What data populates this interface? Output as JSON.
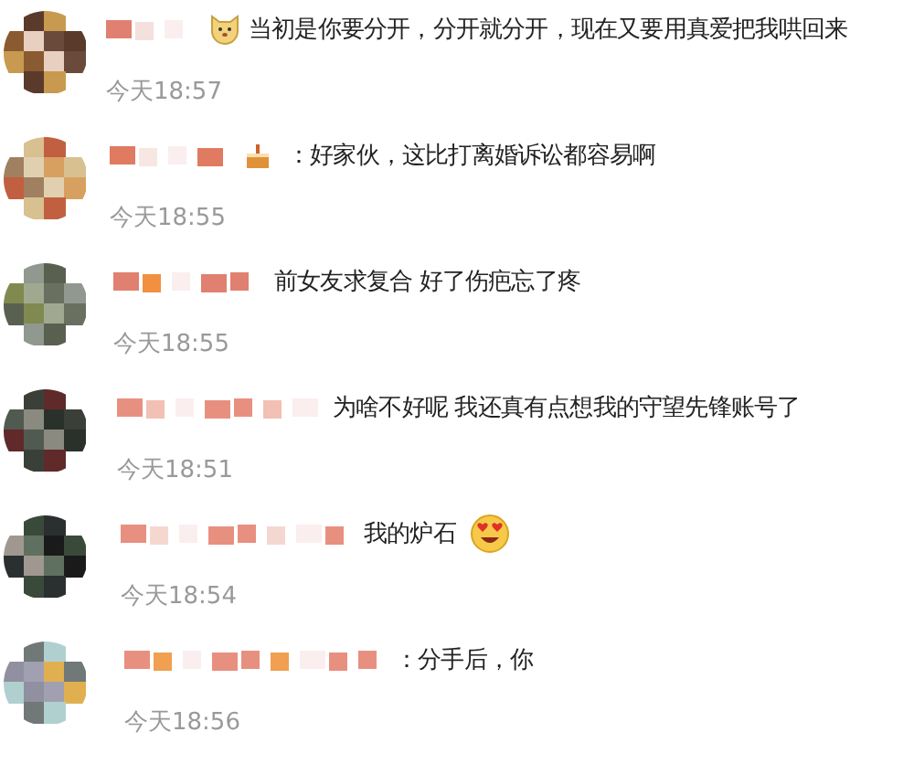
{
  "comments": [
    {
      "parts": [
        {
          "kind": "dog"
        },
        {
          "kind": "text",
          "text": "当初是你要分开，分开就分开，现在又要用真爱把我哄回来"
        }
      ],
      "time": "今天18:57"
    },
    {
      "parts": [
        {
          "kind": "cake"
        },
        {
          "kind": "text",
          "text": "：好家伙，这比打离婚诉讼都容易啊"
        }
      ],
      "time": "今天18:55"
    },
    {
      "parts": [
        {
          "kind": "text",
          "text": "前女友求复合 好了伤疤忘了疼"
        }
      ],
      "time": "今天18:55"
    },
    {
      "parts": [
        {
          "kind": "text",
          "text": "为啥不好呢 我还真有点想我的守望先锋账号了"
        }
      ],
      "time": "今天18:51"
    },
    {
      "parts": [
        {
          "kind": "text",
          "text": "我的炉石"
        },
        {
          "kind": "heart-eyes"
        }
      ],
      "time": "今天18:54"
    },
    {
      "parts": [
        {
          "kind": "text",
          "text": "：分手后，你"
        }
      ],
      "time": "今天18:56"
    }
  ]
}
